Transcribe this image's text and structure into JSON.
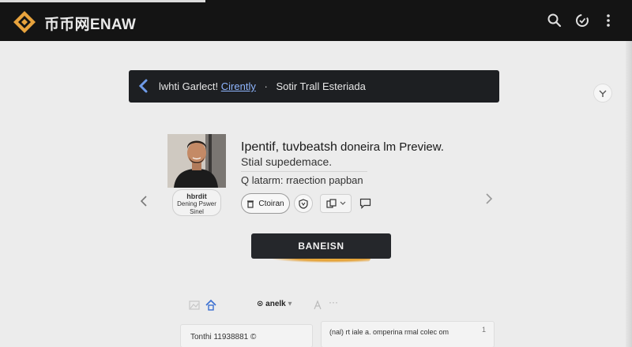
{
  "app": {
    "brand": "币币网ENAW",
    "accent": "#e8a33d",
    "topbar_bg": "#141414",
    "icons": [
      "search-icon",
      "refresh-icon",
      "more-vertical-icon"
    ]
  },
  "banner": {
    "text_before": "lwhti Garlect!",
    "link_text": "Cirently",
    "separator": "·",
    "text_after": "Sotir Trall Esteriada",
    "back_icon": "chevron-left-icon"
  },
  "corner_button": {
    "icon": "bookmark-icon"
  },
  "profile": {
    "avatar_tag_line1": "hbrdit",
    "avatar_tag_line2": "Dening Pswer",
    "avatar_tag_line3": "Sinel",
    "title_main": "Ipentif, tuvbeatsh",
    "title_rest": "doneira lm Preview.",
    "subtitle": "Stial supedemace.",
    "search_text": "Q latarm: rraection papban"
  },
  "actions": {
    "pill_label": "Ctoiran",
    "pill_icon": "trash-icon",
    "shield_icon": "shield-icon",
    "copy_icon": "copy-icon",
    "comment_icon": "comment-icon"
  },
  "navigation": {
    "prev_icon": "chevron-left-icon",
    "next_icon": "chevron-right-icon"
  },
  "cta": {
    "label": "BANEISN"
  },
  "lower_toolbar": {
    "select_label": "⊙ anelk",
    "caret": "▾",
    "more": "···"
  },
  "bottom_cards": {
    "left_text": "Tonthi 11938881 ©",
    "right_text": "(nal) rt iale a. omperina rmal colec om",
    "right_num": "1"
  }
}
